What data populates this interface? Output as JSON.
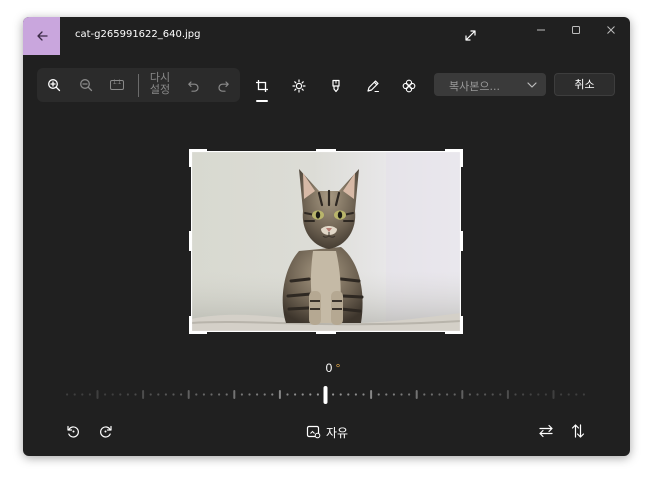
{
  "window": {
    "title": "cat-g265991622_640.jpg",
    "accent_color": "#c9a6dd"
  },
  "title_bar": {
    "back_icon": "arrow-left-icon",
    "expand_icon": "expand-diagonal-icon",
    "minimize_icon": "minimize-icon",
    "maximize_icon": "maximize-icon",
    "close_icon": "close-icon"
  },
  "toolbar": {
    "zoom_in_icon": "zoom-in-icon",
    "zoom_out_icon": "zoom-out-icon",
    "actual_size_label": "1:1",
    "reset_line1": "다시",
    "reset_line2": "설정",
    "undo_icon": "undo-icon",
    "redo_icon": "redo-icon",
    "tools": [
      "crop-icon",
      "brightness-icon",
      "markup-pen-icon",
      "draw-icon",
      "filter-icon"
    ],
    "active_tool": "crop-icon",
    "save_copy_label": "복사본으...",
    "cancel_label": "취소"
  },
  "canvas": {
    "image_subject": "tabby kitten",
    "crop_handles_visible": true
  },
  "straighten": {
    "angle_value": "0",
    "angle_unit": "°",
    "slider_value": 0
  },
  "bottom_bar": {
    "rotate_left_icon": "rotate-left-icon",
    "rotate_right_icon": "rotate-right-icon",
    "aspect_icon": "aspect-ratio-icon",
    "aspect_label": "자유",
    "flip_horizontal_icon": "flip-horizontal-icon",
    "flip_vertical_icon": "flip-vertical-icon"
  }
}
